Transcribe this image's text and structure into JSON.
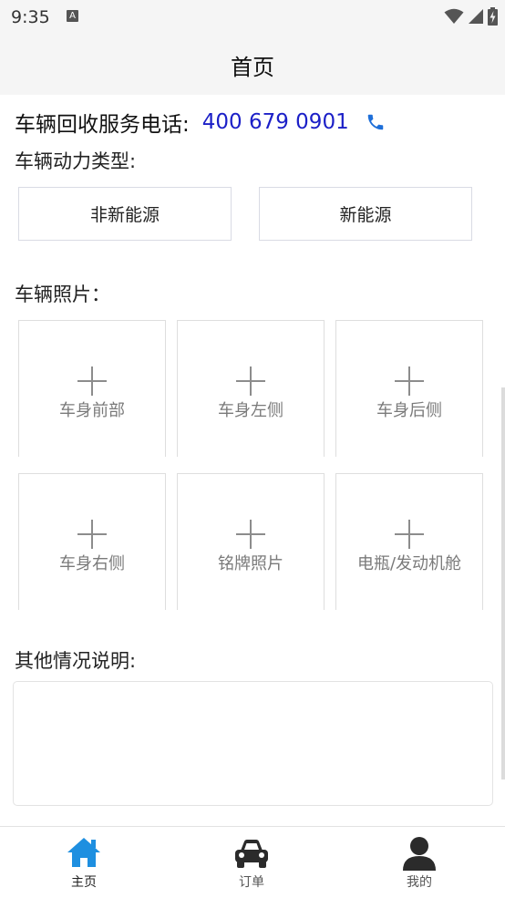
{
  "status_bar": {
    "time": "9:35",
    "notification_badge": "A"
  },
  "app_bar": {
    "title": "首页"
  },
  "hotline": {
    "label": "车辆回收服务电话:",
    "number": "400 679 0901"
  },
  "power_type": {
    "label": "车辆动力类型:",
    "options": [
      "非新能源",
      "新能源"
    ]
  },
  "photos": {
    "label": "车辆照片：",
    "slots": [
      "车身前部",
      "车身左侧",
      "车身后侧",
      "车身右侧",
      "铭牌照片",
      "电瓶/发动机舱"
    ]
  },
  "remarks": {
    "label": "其他情况说明:",
    "value": ""
  },
  "tabbar": {
    "items": [
      {
        "label": "主页",
        "icon": "home-icon",
        "active": true
      },
      {
        "label": "订单",
        "icon": "car-icon",
        "active": false
      },
      {
        "label": "我的",
        "icon": "user-icon",
        "active": false
      }
    ]
  },
  "colors": {
    "link": "#1b1fc7",
    "phone_icon": "#1e6fd9",
    "home_active": "#1e8fe0",
    "tab_inactive": "#2b2b2b"
  },
  "icons": [
    "phone-icon",
    "wifi-icon",
    "signal-icon",
    "battery-icon",
    "plus-icon"
  ]
}
